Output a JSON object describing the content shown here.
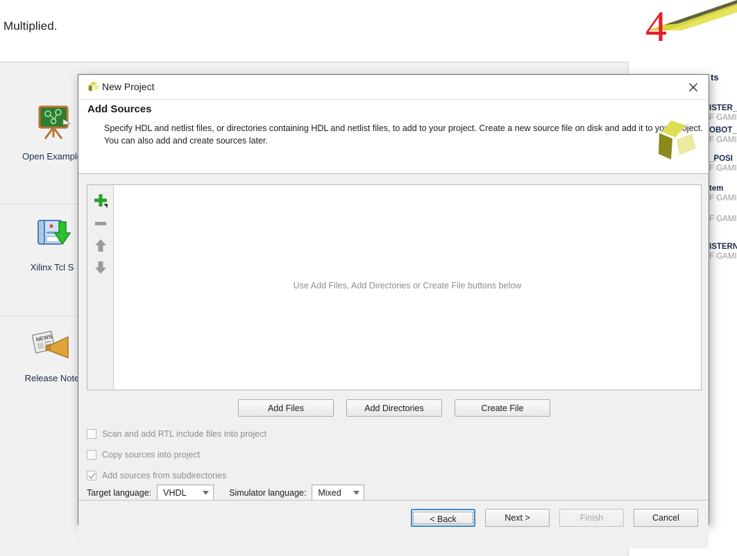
{
  "background": {
    "banner_text": "y. Multiplied.",
    "big_number": "4",
    "accent_red": "#e2202c",
    "swoosh_yellow": "#d6d53a",
    "swoosh_dark": "#4c4c4c",
    "quick_start": [
      {
        "label": "Open Example",
        "icon": "chalkboard-icon"
      },
      {
        "label": "Xilinx Tcl S",
        "icon": "tcl-store-icon"
      },
      {
        "label": "Release Note",
        "icon": "release-notes-icon"
      }
    ],
    "recent_panel": {
      "title": "ts",
      "items": [
        {
          "name": "ISTER_",
          "sub": "F GAMI"
        },
        {
          "name": "OBOT_",
          "sub": "F GAMI"
        },
        {
          "name": "_POSI",
          "sub": "F GAMI"
        },
        {
          "name": "tem",
          "sub": "F GAMI"
        },
        {
          "name": "",
          "sub": "F GAMI"
        },
        {
          "name": "ISTERN",
          "sub": "F GAMI"
        }
      ]
    }
  },
  "dialog": {
    "window_title": "New Project",
    "title_icon": "vivado-logo-icon",
    "close_icon": "close-icon",
    "heading": "Add Sources",
    "description": "Specify HDL and netlist files, or directories containing HDL and netlist files, to add to your project. Create a new source file on disk and add it to your project. You can also add and create sources later.",
    "logo_icon": "vivado-logo-icon",
    "list": {
      "empty_message": "Use Add Files, Add Directories or Create File buttons below",
      "toolbar": [
        {
          "name": "add-icon",
          "glyph": "+",
          "color": "#2aa12a",
          "has_dropdown": true
        },
        {
          "name": "remove-icon",
          "glyph": "−",
          "color": "#9a9a9a",
          "has_dropdown": false
        },
        {
          "name": "move-up-icon",
          "glyph": "↑",
          "color": "#9a9a9a",
          "has_dropdown": false
        },
        {
          "name": "move-down-icon",
          "glyph": "↓",
          "color": "#9a9a9a",
          "has_dropdown": false
        }
      ]
    },
    "actions": [
      {
        "label": "Add Files",
        "name": "add-files-button"
      },
      {
        "label": "Add Directories",
        "name": "add-directories-button"
      },
      {
        "label": "Create File",
        "name": "create-file-button"
      }
    ],
    "options": [
      {
        "label": "Scan and add RTL include files into project",
        "checked": false,
        "enabled": false,
        "mnemonic_index": 22
      },
      {
        "label": "Copy sources into project",
        "checked": false,
        "enabled": false,
        "mnemonic_index": 5
      },
      {
        "label": "Add sources from subdirectories",
        "checked": true,
        "enabled": false,
        "mnemonic_index": 11
      }
    ],
    "target_language": {
      "label": "Target language:",
      "value": "VHDL"
    },
    "simulator_language": {
      "label": "Simulator language:",
      "value": "Mixed"
    },
    "footer": {
      "back": "< Back",
      "next": "Next >",
      "finish": "Finish",
      "cancel": "Cancel"
    }
  }
}
